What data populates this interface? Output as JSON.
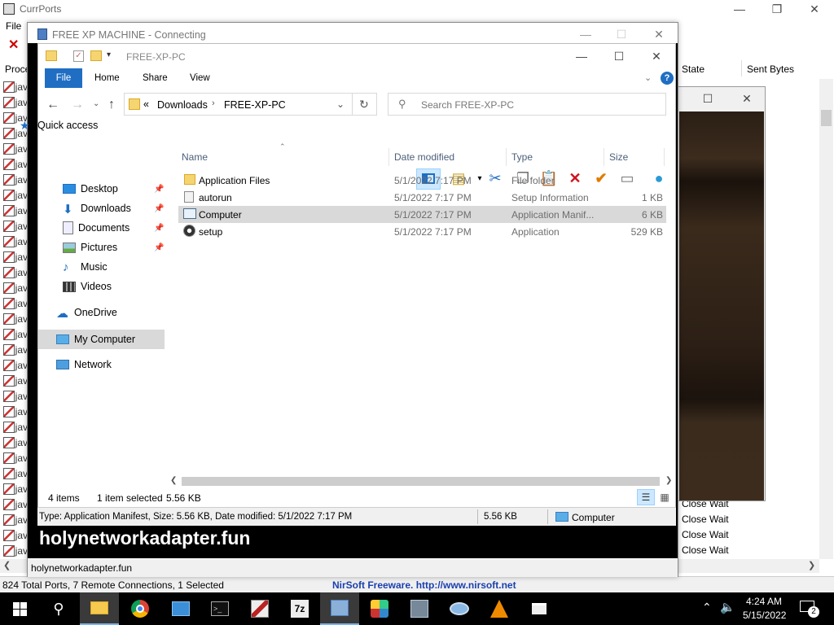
{
  "currports": {
    "title": "CurrPorts",
    "menu": [
      "File"
    ],
    "columns": {
      "process": "Proce",
      "state": "State",
      "sent": "Sent Bytes"
    },
    "row_text": "jav",
    "state_rows": [
      "Close Wait",
      "Close Wait",
      "Close Wait",
      "Close Wait",
      "Close Wait"
    ],
    "status_left": "824 Total Ports, 7 Remote Connections, 1 Selected",
    "status_right": "NirSoft Freeware.  http://www.nirsoft.net"
  },
  "connecting": {
    "title": "FREE XP MACHINE - Connecting",
    "banner": "holynetworkadapter.fun",
    "status": "holynetworkadapter.fun"
  },
  "explorer": {
    "title": "FREE-XP-PC",
    "ribbon_tabs": [
      "File",
      "Home",
      "Share",
      "View"
    ],
    "address": {
      "prefix": "«",
      "parts": [
        "Downloads",
        "FREE-XP-PC"
      ]
    },
    "search_placeholder": "Search FREE-XP-PC",
    "nav": {
      "quick_access": "Quick access",
      "desktop": "Desktop",
      "downloads": "Downloads",
      "documents": "Documents",
      "pictures": "Pictures",
      "music": "Music",
      "videos": "Videos",
      "onedrive": "OneDrive",
      "my_computer": "My Computer",
      "network": "Network"
    },
    "columns": {
      "name": "Name",
      "date": "Date modified",
      "type": "Type",
      "size": "Size"
    },
    "files": [
      {
        "name": "Application Files",
        "date": "5/1/2022 7:17 PM",
        "type": "File folder",
        "size": "",
        "icon": "folder-icon"
      },
      {
        "name": "autorun",
        "date": "5/1/2022 7:17 PM",
        "type": "Setup Information",
        "size": "1 KB",
        "icon": "setup-info-icon"
      },
      {
        "name": "Computer",
        "date": "5/1/2022 7:17 PM",
        "type": "Application Manif...",
        "size": "6 KB",
        "icon": "manifest-icon"
      },
      {
        "name": "setup",
        "date": "5/1/2022 7:17 PM",
        "type": "Application",
        "size": "529 KB",
        "icon": "setup-icon"
      }
    ],
    "status": {
      "count": "4 items",
      "selected": "1 item selected",
      "size": "5.56 KB"
    },
    "details_bar": {
      "text": "Type: Application Manifest, Size: 5.56 KB, Date modified: 5/1/2022 7:17 PM",
      "size": "5.56 KB",
      "location": "Computer"
    }
  },
  "taskbar": {
    "time": "4:24 AM",
    "date": "5/15/2022",
    "notifications": "2"
  },
  "colors": {
    "accent": "#1f6ec3",
    "selection": "#cce8ff",
    "selected_row": "#d9d9d9",
    "taskbar": "#000000"
  }
}
